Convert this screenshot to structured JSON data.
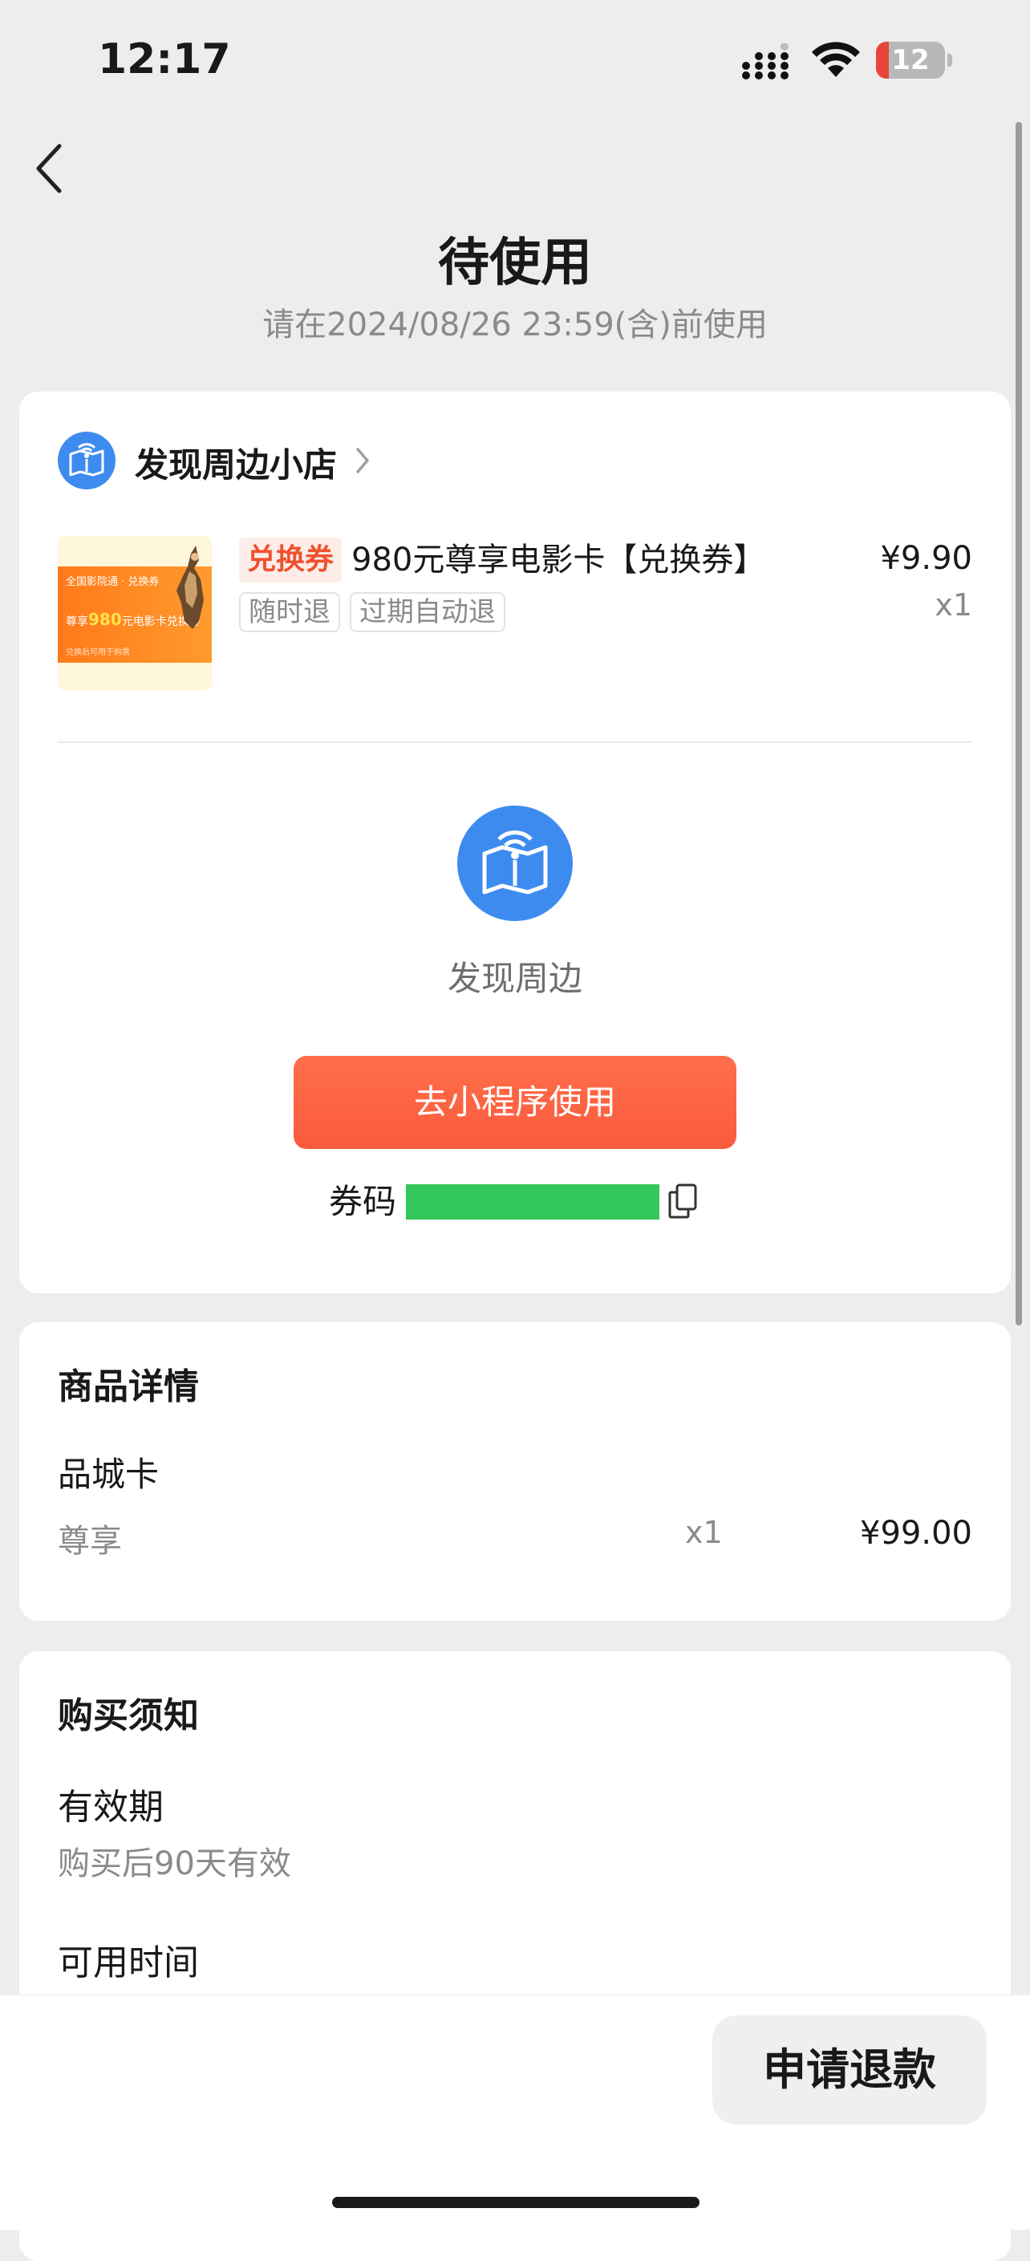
{
  "status_bar": {
    "time": "12:17",
    "battery": "12"
  },
  "header": {
    "title": "待使用",
    "subtitle": "请在2024/08/26 23:59(含)前使用"
  },
  "order": {
    "shop_name": "发现周边小店",
    "product": {
      "tag": "兑换券",
      "name": "980元尊享电影卡【兑换券】",
      "price": "¥9.90",
      "qty": "x1",
      "labels": [
        "随时退",
        "过期自动退"
      ],
      "thumb": {
        "line1": "全国影院通 · 兑换券",
        "line2_prefix": "尊享",
        "line2_amount": "980",
        "line2_suffix": "元电影卡兑换券",
        "line3": "兑换后可用于购票"
      }
    },
    "provider_label": "发现周边",
    "use_button": "去小程序使用",
    "code_label": "券码"
  },
  "details": {
    "title": "商品详情",
    "item_name": "品城卡",
    "spec": "尊享",
    "qty": "x1",
    "price": "¥99.00"
  },
  "notice": {
    "title": "购买须知",
    "items": [
      {
        "heading": "有效期",
        "value": "购买后90天有效"
      },
      {
        "heading": "可用时间",
        "value": ""
      }
    ]
  },
  "actions": {
    "refund": "申请退款"
  },
  "colors": {
    "accent": "#FA5A3C",
    "brand_blue": "#3E8BF0",
    "code_mask": "#34C759",
    "background": "#EDEDED"
  },
  "icons": {
    "back": "chevron-left-icon",
    "shop": "map-signal-icon",
    "copy": "copy-icon"
  }
}
